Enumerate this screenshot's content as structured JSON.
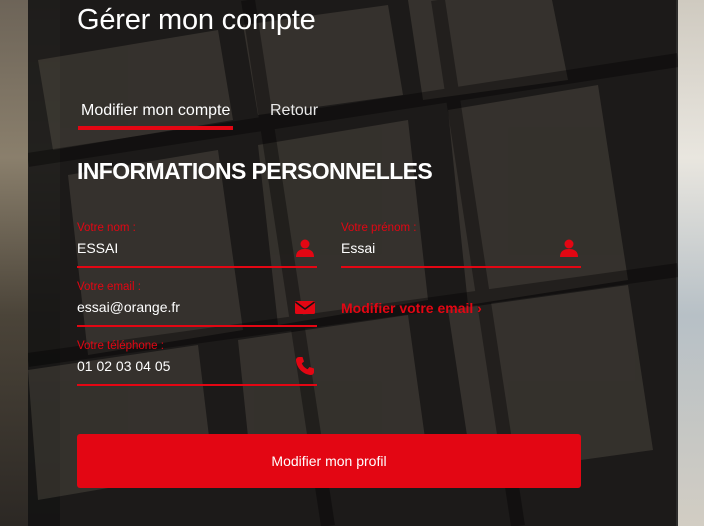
{
  "page": {
    "title": "Gérer mon compte"
  },
  "tabs": [
    {
      "label": "Modifier mon compte",
      "active": true
    },
    {
      "label": "Retour",
      "active": false
    }
  ],
  "section": {
    "title": "INFORMATIONS PERSONNELLES"
  },
  "form": {
    "nom": {
      "label": "Votre nom :",
      "value": "ESSAI",
      "icon": "user-icon"
    },
    "prenom": {
      "label": "Votre prénom :",
      "value": "Essai",
      "icon": "user-icon"
    },
    "email": {
      "label": "Votre email :",
      "value": "essai@orange.fr",
      "icon": "envelope-icon"
    },
    "telephone": {
      "label": "Votre téléphone :",
      "value": "01 02 03 04 05",
      "icon": "phone-icon"
    },
    "email_link": "Modifier votre email ›",
    "submit_label": "Modifier mon profil"
  },
  "colors": {
    "accent": "#e30613",
    "panel": "#121212",
    "text": "#ffffff"
  }
}
